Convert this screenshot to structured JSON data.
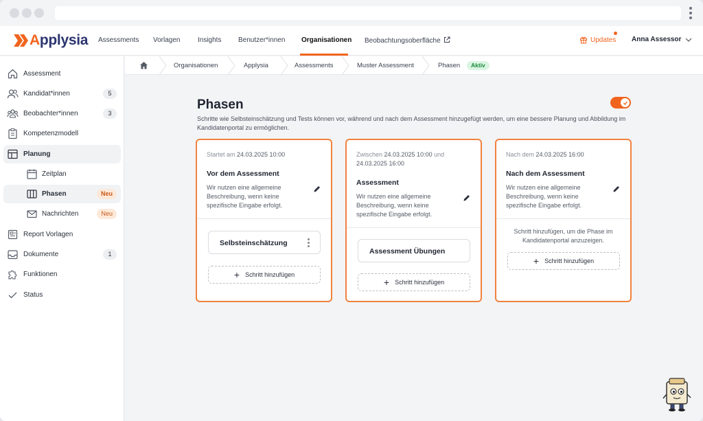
{
  "app": {
    "brand_prefix": "A",
    "brand_rest": "pplysia",
    "accent": "#f0641e",
    "brand_blue": "#2b3470"
  },
  "topnav": {
    "items": [
      "Assessments",
      "Vorlagen",
      "Insights",
      "Benutzer*innen",
      "Organisationen",
      "Beobachtungsoberfläche"
    ],
    "active": "Organisationen",
    "updates_label": "Updates",
    "user_name": "Anna Assessor"
  },
  "sidebar": {
    "items": [
      {
        "label": "Assessment",
        "icon": "home-icon"
      },
      {
        "label": "Kandidat*innen",
        "icon": "users-icon",
        "badge": "5"
      },
      {
        "label": "Beobachter*innen",
        "icon": "group-icon",
        "badge": "3"
      },
      {
        "label": "Kompetenzmodell",
        "icon": "clipboard-icon"
      },
      {
        "label": "Planung",
        "icon": "layout-icon",
        "selected": true
      },
      {
        "label": "Zeitplan",
        "icon": "calendar-icon"
      },
      {
        "label": "Phasen",
        "icon": "columns-icon",
        "badge": "Neu",
        "selected": true
      },
      {
        "label": "Nachrichten",
        "icon": "mail-icon",
        "badge": "Neu"
      },
      {
        "label": "Report Vorlagen",
        "icon": "report-icon"
      },
      {
        "label": "Dokumente",
        "icon": "inbox-icon",
        "badge": "1"
      },
      {
        "label": "Funktionen",
        "icon": "puzzle-icon"
      },
      {
        "label": "Status",
        "icon": "check-icon"
      }
    ]
  },
  "breadcrumb": {
    "items": [
      "Organisationen",
      "Applysia",
      "Assessments",
      "Muster Assessment",
      "Phasen"
    ],
    "status_badge": "Aktiv"
  },
  "page": {
    "title": "Phasen",
    "description": "Schritte wie Selbsteinschätzung und Tests können vor, während und nach dem Assessment hinzugefügt werden, um eine bessere Planung und Abbildung im Kandidatenportal zu ermöglichen.",
    "toggle_on": true
  },
  "cards": [
    {
      "when_prefix": "Startet am ",
      "when_value": "24.03.2025 10:00",
      "title": "Vor dem Assessment",
      "description": "Wir nutzen eine allgemeine Beschreibung, wenn keine spezifische Eingabe erfolgt.",
      "steps": [
        "Selbsteinschätzung"
      ],
      "add_label": "Schritt hinzufügen"
    },
    {
      "when_prefix": "Zwischen ",
      "when_value": "24.03.2025 10:00",
      "when_mid": " und ",
      "when_value2": "24.03.2025 16:00",
      "title": "Assessment",
      "description": "Wir nutzen eine allgemeine Beschreibung, wenn keine spezifische Eingabe erfolgt.",
      "steps": [
        "Assessment Übungen"
      ],
      "add_label": "Schritt hinzufügen"
    },
    {
      "when_prefix": "Nach dem ",
      "when_value": "24.03.2025 16:00",
      "title": "Nach dem Assessment",
      "description": "Wir nutzen eine allgemeine Beschreibung, wenn keine spezifische Eingabe erfolgt.",
      "hint": "Schritt hinzufügen, um die Phase im Kandidatenportal anzuzeigen.",
      "add_label": "Schritt hinzufügen"
    }
  ]
}
